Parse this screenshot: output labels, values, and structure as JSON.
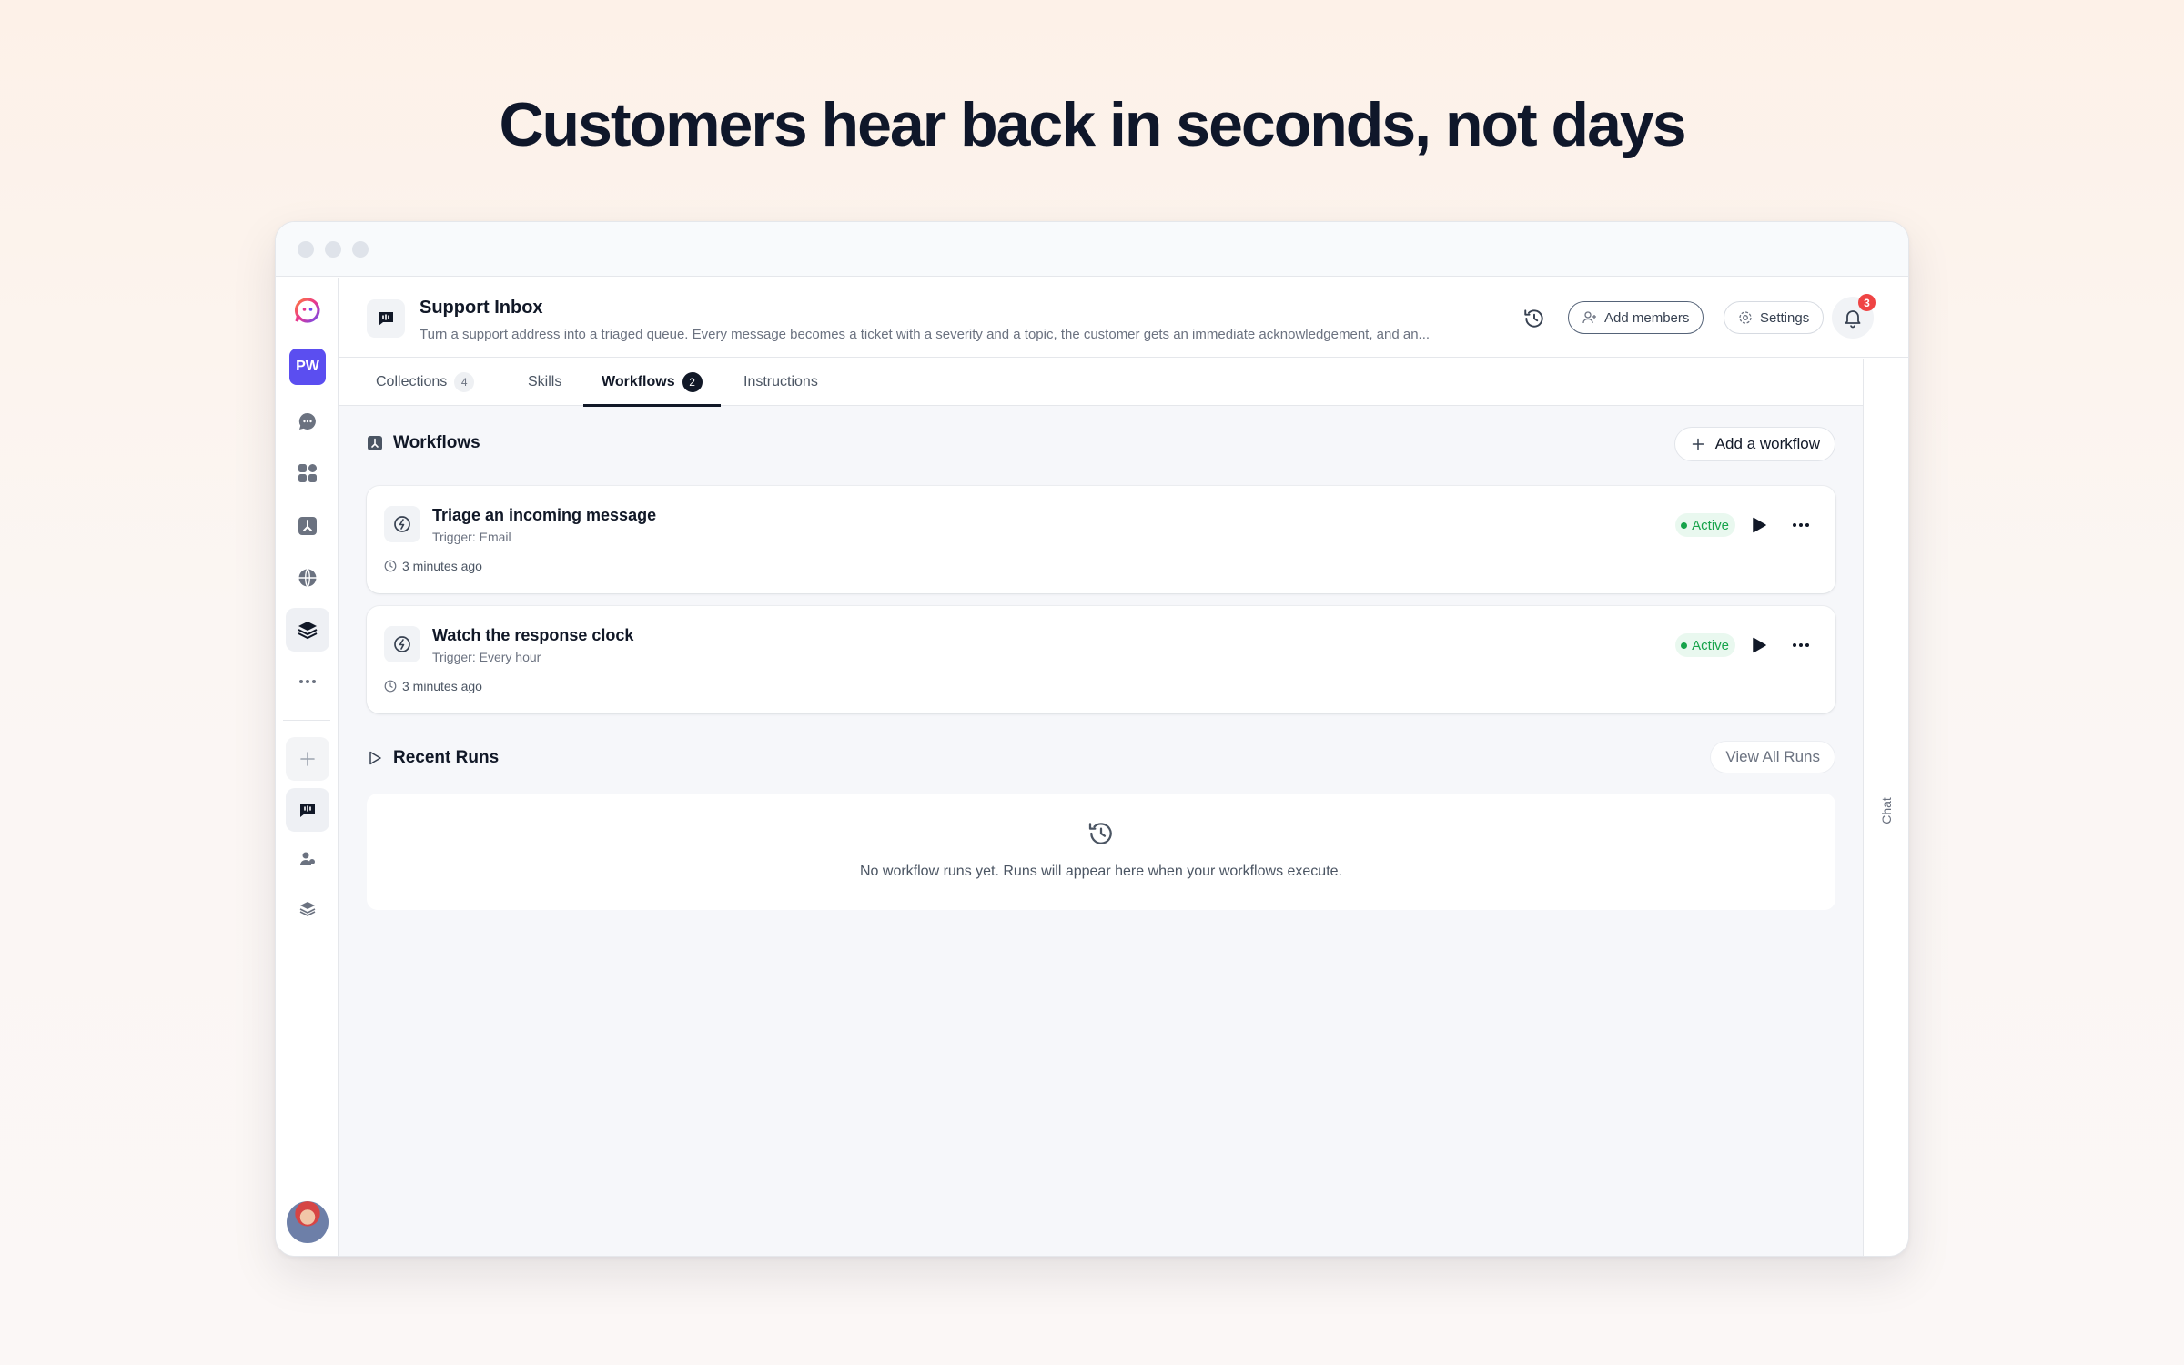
{
  "headline": "Customers hear back in seconds, not days",
  "workspace": {
    "initials": "PW"
  },
  "header": {
    "title": "Support Inbox",
    "description": "Turn a support address into a triaged queue. Every message becomes a ticket with a severity and a topic, the customer gets an immediate acknowledgement, and an...",
    "add_members_label": "Add members",
    "settings_label": "Settings",
    "notification_count": "3"
  },
  "tabs": [
    {
      "label": "Collections",
      "count": "4"
    },
    {
      "label": "Skills"
    },
    {
      "label": "Workflows",
      "count": "2"
    },
    {
      "label": "Instructions"
    }
  ],
  "workflows": {
    "section_title": "Workflows",
    "add_label": "Add a workflow",
    "items": [
      {
        "title": "Triage an incoming message",
        "trigger": "Trigger: Email",
        "time": "3 minutes ago",
        "status": "Active"
      },
      {
        "title": "Watch the response clock",
        "trigger": "Trigger: Every hour",
        "time": "3 minutes ago",
        "status": "Active"
      }
    ]
  },
  "recent_runs": {
    "section_title": "Recent Runs",
    "view_all_label": "View All Runs",
    "empty_text": "No workflow runs yet. Runs will appear here when your workflows execute."
  },
  "chat_label": "Chat",
  "colors": {
    "accent": "#5b4ef0",
    "active_green": "#16a34a",
    "badge_red": "#ef4444"
  }
}
